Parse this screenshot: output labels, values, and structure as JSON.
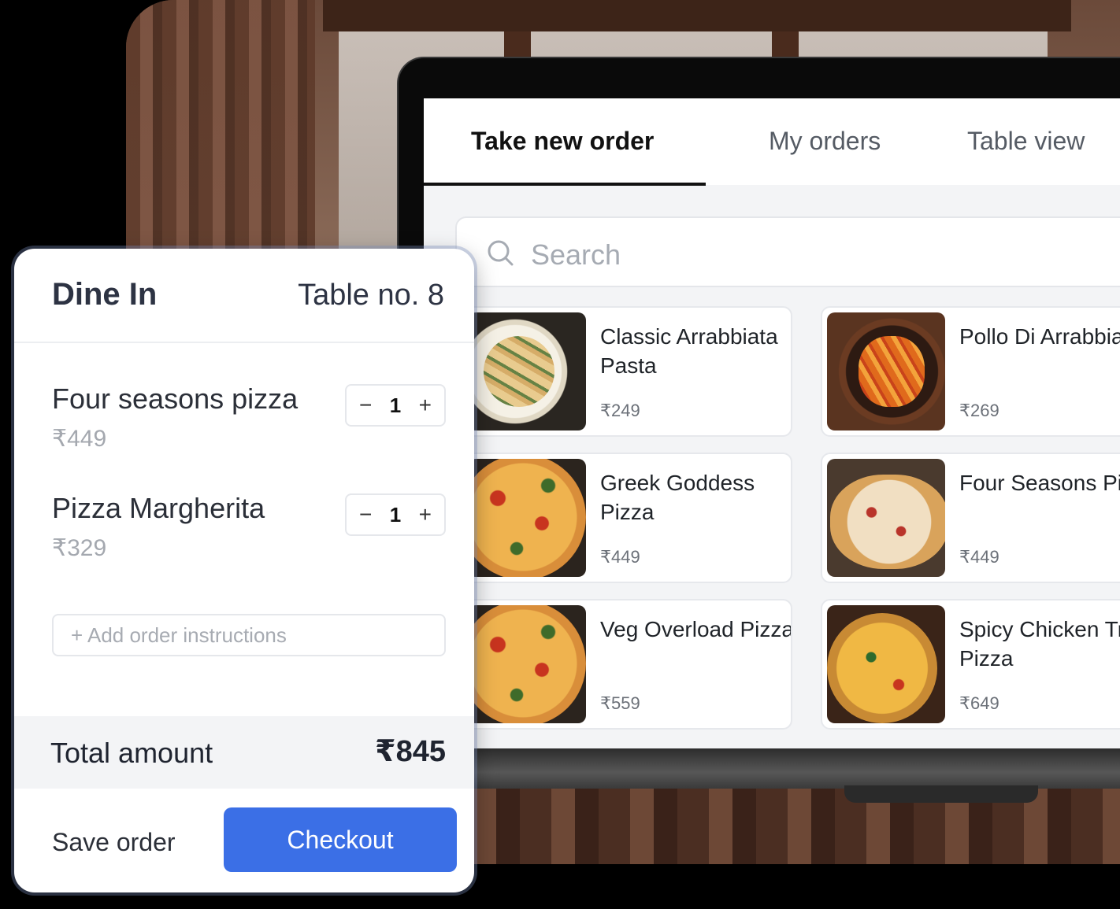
{
  "laptop": {
    "tabs": [
      {
        "label": "Take new order",
        "active": true
      },
      {
        "label": "My orders",
        "active": false
      },
      {
        "label": "Table view",
        "active": false
      }
    ],
    "search": {
      "placeholder": "Search"
    },
    "menu": [
      {
        "name": "Classic Arrabbiata Pasta",
        "price": "₹249"
      },
      {
        "name": "Pollo Di Arrabbiata Pasta",
        "price": "₹269"
      },
      {
        "name": "Greek Goddess Pizza",
        "price": "₹449"
      },
      {
        "name": "Four Seasons Pizza",
        "price": "₹449"
      },
      {
        "name": "Veg Overload Pizza",
        "price": "₹559"
      },
      {
        "name": "Spicy Chicken Treat Pizza",
        "price": "₹649"
      }
    ]
  },
  "order": {
    "type": "Dine In",
    "table": "Table no. 8",
    "items": [
      {
        "name": "Four seasons pizza",
        "price": "₹449",
        "qty": "1"
      },
      {
        "name": "Pizza Margherita",
        "price": "₹329",
        "qty": "1"
      }
    ],
    "instructions_placeholder": "+ Add order instructions",
    "total_label": "Total amount",
    "total_value": "₹845",
    "save_label": "Save order",
    "checkout_label": "Checkout",
    "accent": "#3b6fe6"
  }
}
